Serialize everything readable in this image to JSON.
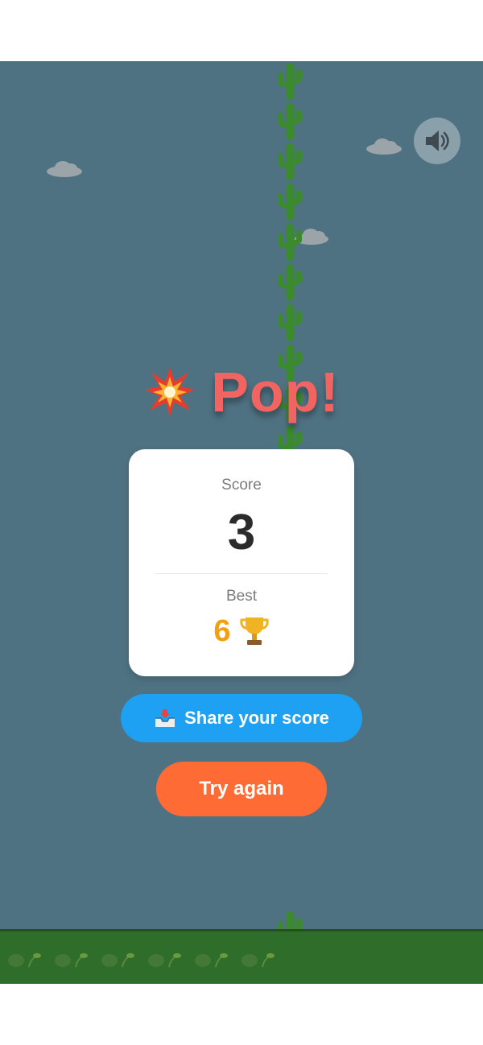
{
  "game": {
    "title": "Pop!",
    "score_label": "Score",
    "score_value": "3",
    "best_label": "Best",
    "best_value": "6",
    "share_label": "Share your score",
    "try_again_label": "Try again"
  },
  "icons": {
    "sound": "speaker-icon",
    "title": "explosion-icon",
    "best": "trophy-icon",
    "share": "inbox-tray-icon",
    "obstacle": "cactus-icon",
    "cloud": "cloud-icon",
    "ground_decor": "sprout-icon"
  },
  "colors": {
    "sky": "#4f7282",
    "ground": "#2f6e2a",
    "title": "#f26461",
    "best": "#f2a012",
    "share_button": "#1ea1f2",
    "try_again_button": "#ff6b35"
  }
}
